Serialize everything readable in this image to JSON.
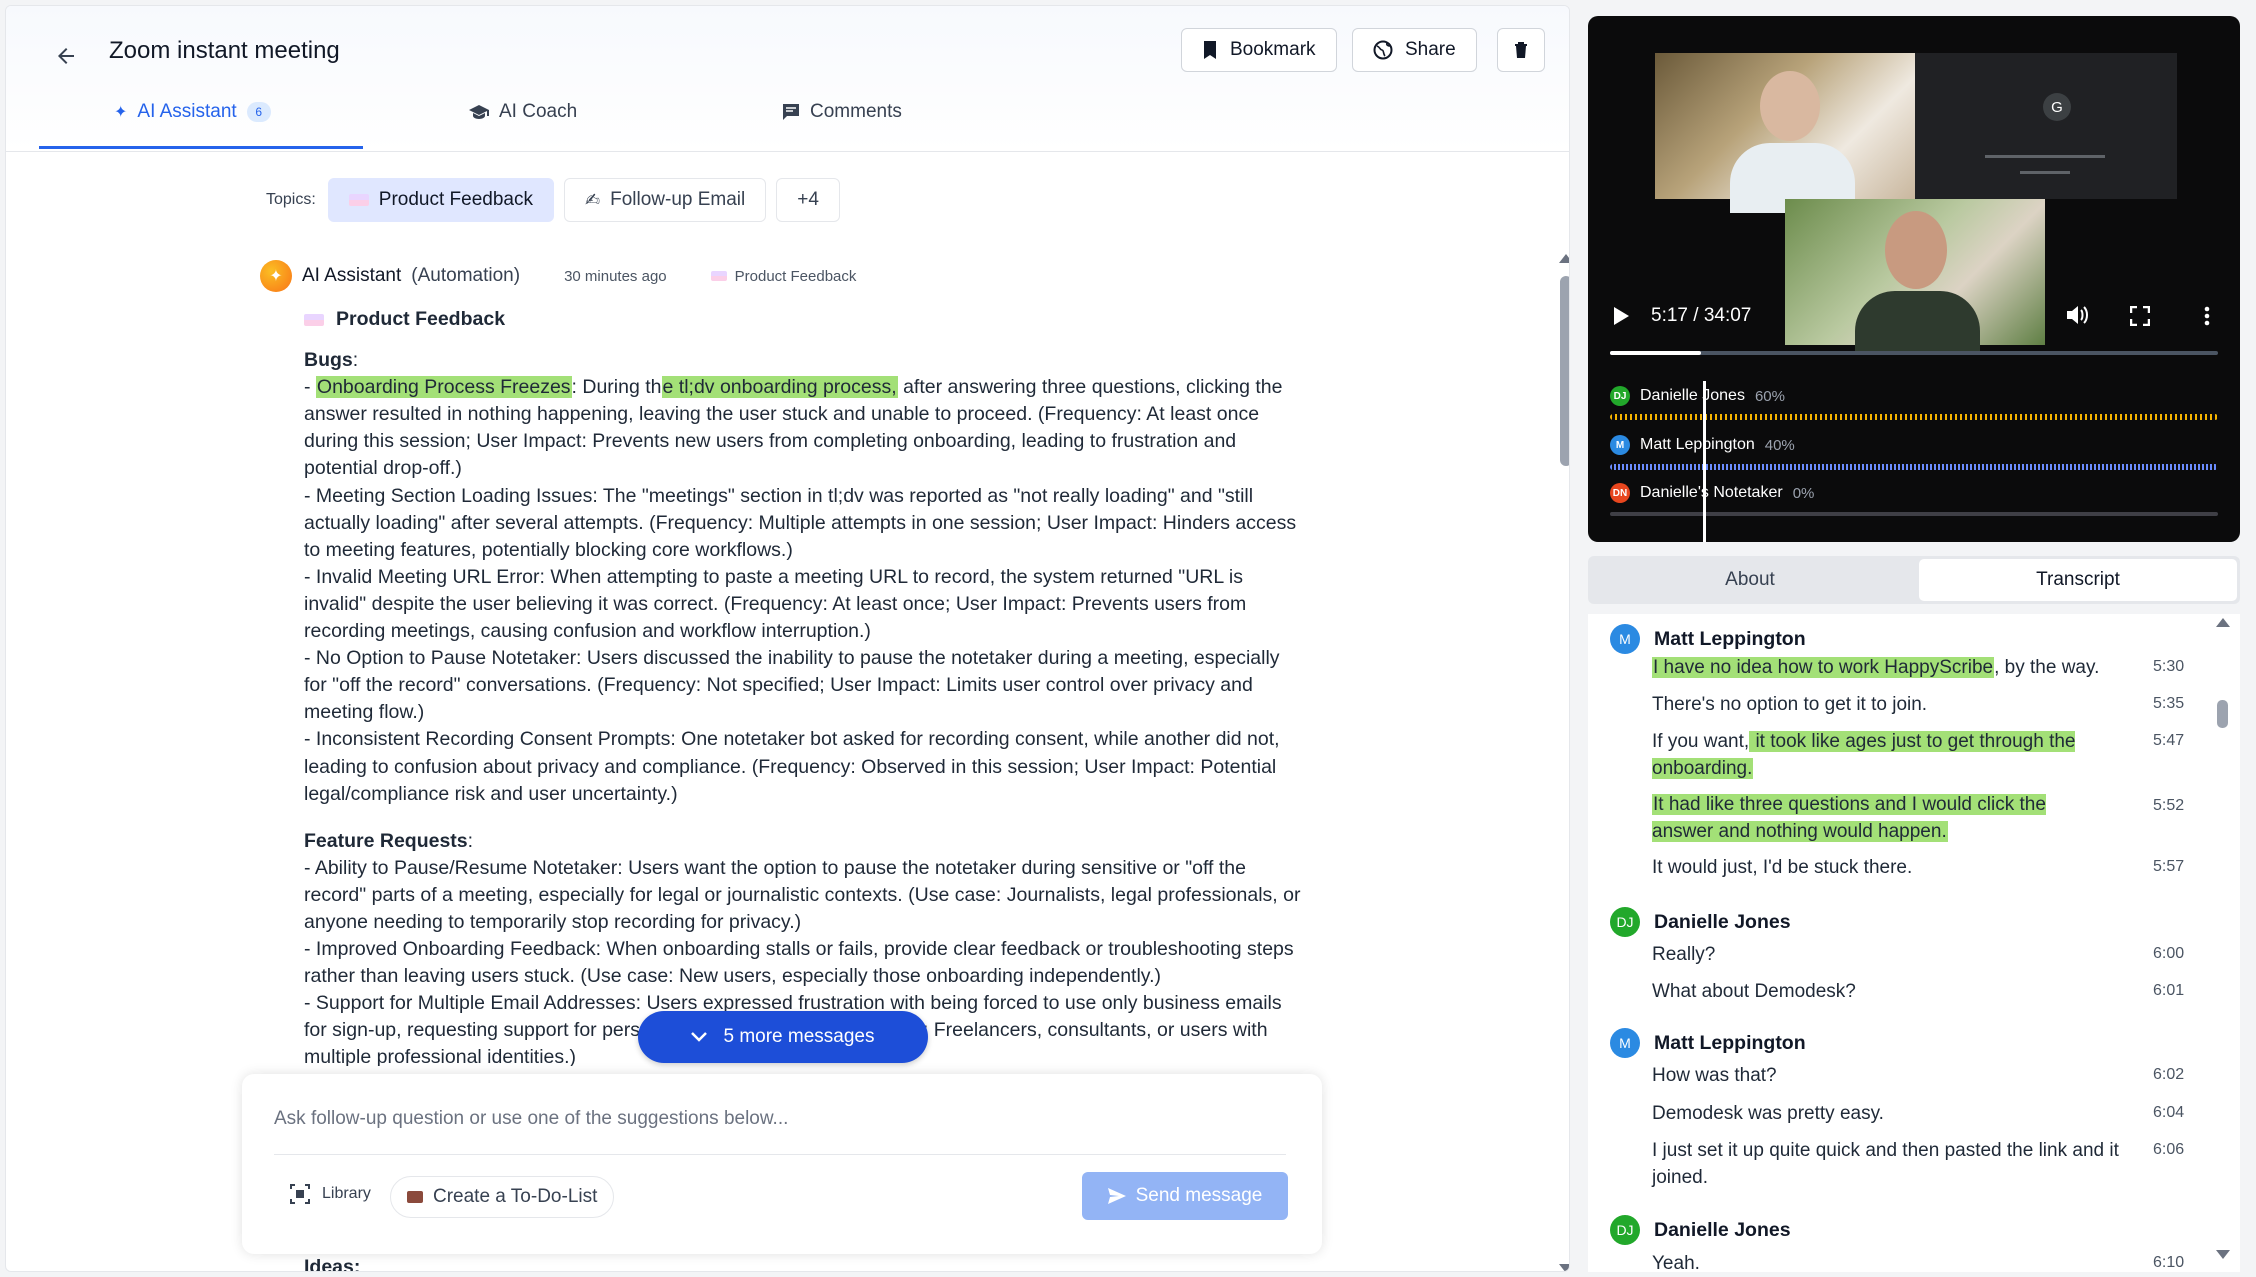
{
  "header": {
    "title": "Zoom instant meeting",
    "bookmark_label": "Bookmark",
    "share_label": "Share"
  },
  "tabs": {
    "ai_assistant": "AI Assistant",
    "ai_assistant_count": "6",
    "ai_coach": "AI Coach",
    "comments": "Comments"
  },
  "topics": {
    "label": "Topics:",
    "items": [
      "Product Feedback",
      "Follow-up Email"
    ],
    "more": "+4"
  },
  "message": {
    "author": "AI Assistant",
    "role": "(Automation)",
    "time": "30 minutes ago",
    "topic": "Product Feedback",
    "section_title": "Product Feedback",
    "bugs_heading": "Bugs",
    "bug1_h1": "Onboarding Process Freezes",
    "bug1_mid": ": During th",
    "bug1_h2": "e tl;dv onboarding process,",
    "bug1_rest": " after answering three questions, clicking the answer resulted in nothing happening, leaving the user stuck and unable to proceed. (Frequency: At least once during this session; User Impact: Prevents new users from completing onboarding, leading to frustration and potential drop-off.)",
    "bug2": "- Meeting Section Loading Issues: The \"meetings\" section in tl;dv was reported as \"not really loading\" and \"still actually loading\" after several attempts. (Frequency: Multiple attempts in one session; User Impact: Hinders access to meeting features, potentially blocking core workflows.)",
    "bug3": "- Invalid Meeting URL Error: When attempting to paste a meeting URL to record, the system returned \"URL is invalid\" despite the user believing it was correct. (Frequency: At least once; User Impact: Prevents users from recording meetings, causing confusion and workflow interruption.)",
    "bug4": "- No Option to Pause Notetaker: Users discussed the inability to pause the notetaker during a meeting, especially for \"off the record\" conversations. (Frequency: Not specified; User Impact: Limits user control over privacy and meeting flow.)",
    "bug5": "- Inconsistent Recording Consent Prompts: One notetaker bot asked for recording consent, while another did not, leading to confusion about privacy and compliance. (Frequency: Observed in this session; User Impact: Potential legal/compliance risk and user uncertainty.)",
    "features_heading": "Feature Requests",
    "feature1": "- Ability to Pause/Resume Notetaker: Users want the option to pause the notetaker during sensitive or \"off the record\" parts of a meeting, especially for legal or journalistic contexts. (Use case: Journalists, legal professionals, or anyone needing to temporarily stop recording for privacy.)",
    "feature2": "- Improved Onboarding Feedback: When onboarding stalls or fails, provide clear feedback or troubleshooting steps rather than leaving users stuck. (Use case: New users, especially those onboarding independently.)",
    "feature3": "- Support for Multiple Email Addresses: Users expressed frustration with being forced to use only business emails for sign-up, requesting support for personal email addresses. (Use case: Freelancers, consultants, or users with multiple pro",
    "feature3_tail": "fessional identities.)",
    "ideas_heading": "Ideas"
  },
  "more_messages": "5 more messages",
  "composer": {
    "placeholder": "Ask follow-up question or use one of the suggestions below...",
    "library": "Library",
    "todo": "Create a To-Do-List",
    "send": "Send message"
  },
  "video": {
    "time": "5:17 / 34:07",
    "progress": 0.15,
    "speakers": [
      {
        "initials": "DJ",
        "name": "Danielle Jones",
        "pct": "60%",
        "color": "#22a82b"
      },
      {
        "initials": "M",
        "name": "Matt Leppington",
        "pct": "40%",
        "color": "#2b8ae2"
      },
      {
        "initials": "DN",
        "name": "Danielle's Notetaker",
        "pct": "0%",
        "color": "#e8461e"
      }
    ]
  },
  "right_tabs": {
    "about": "About",
    "transcript": "Transcript"
  },
  "transcript": {
    "s1": "Matt Leppington",
    "l1_h": "I have no idea how to work HappyScribe",
    "l1_rest": ", by the way.",
    "t1": "5:30",
    "l2": "There's no option to get it to join.",
    "t2": "5:35",
    "l3_pre": "If you want,",
    "l3_h": " it took like ages just to get through the onboarding.",
    "t3": "5:47",
    "l4_h": "It had like three questions and I would click the answer and nothing would happen.",
    "t4": "5:52",
    "l5": "It would just, I'd be stuck there.",
    "t5": "5:57",
    "s2": "Danielle Jones",
    "l6": "Really?",
    "t6": "6:00",
    "l7": "What about Demodesk?",
    "t7": "6:01",
    "s3": "Matt Leppington",
    "l8": "How was that?",
    "t8": "6:02",
    "l9": "Demodesk was pretty easy.",
    "t9": "6:04",
    "l10": "I just set it up quite quick and then pasted the link and it joined.",
    "t10": "6:06",
    "s4": "Danielle Jones",
    "l11": "Yeah.",
    "t11": "6:10"
  }
}
